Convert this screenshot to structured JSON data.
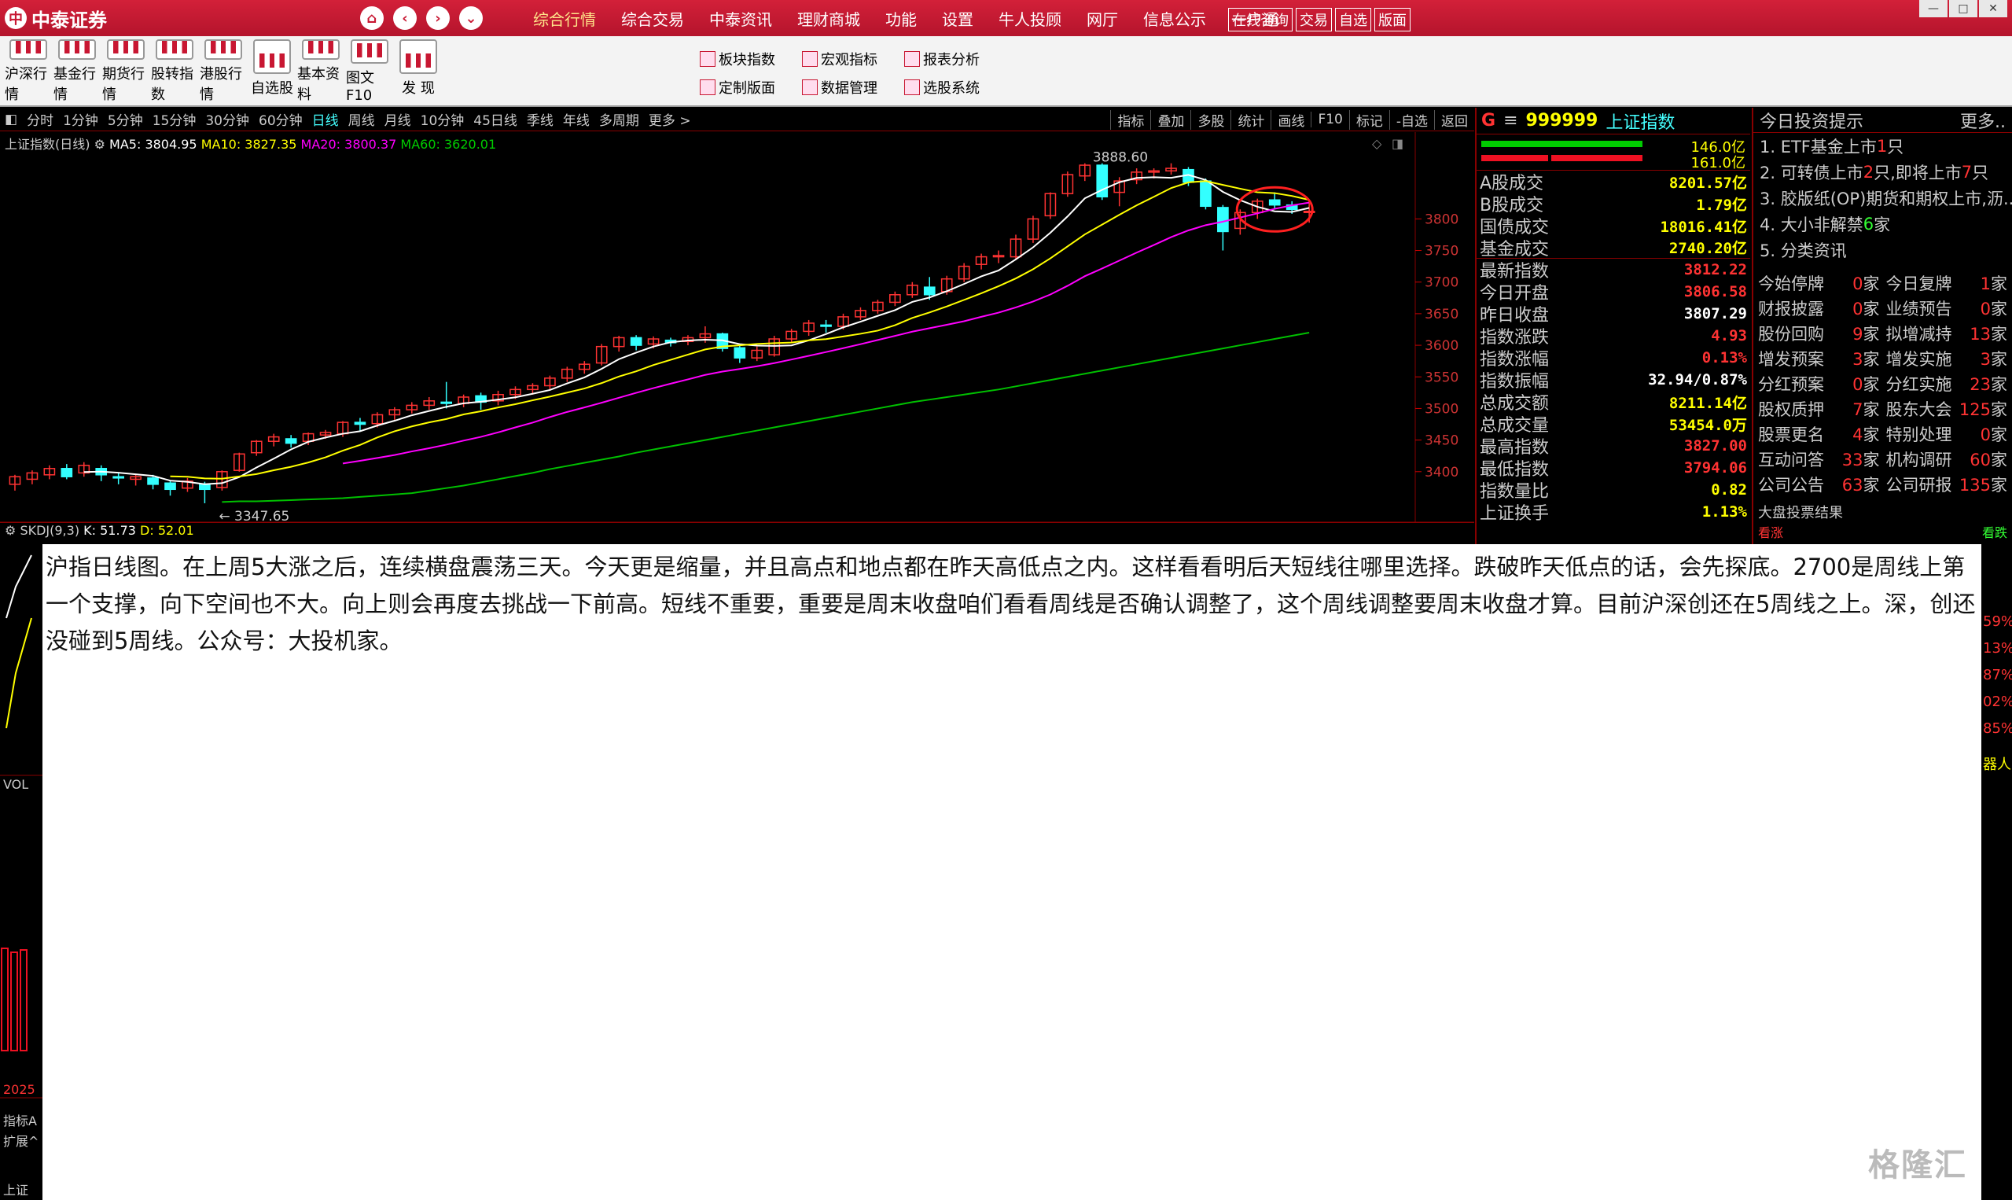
{
  "app": {
    "brand": "中泰证券",
    "brand_mark": "中"
  },
  "nav_icons": [
    "home-icon",
    "back-icon",
    "forward-icon",
    "dropdown-icon"
  ],
  "menu": [
    "综合行情",
    "综合交易",
    "中泰资讯",
    "理财商城",
    "功能",
    "设置",
    "牛人投顾",
    "网厅",
    "信息公示",
    "一户通"
  ],
  "quick_buttons": [
    "在线咨询",
    "交易",
    "自选",
    "版面"
  ],
  "window_controls": [
    "—",
    "□",
    "✕"
  ],
  "toolbar": {
    "buttons": [
      "沪深行情",
      "基金行情",
      "期货行情",
      "股转指数",
      "港股行情",
      "自选股",
      "基本资料",
      "图文F10",
      "发 现"
    ],
    "small": [
      "板块指数",
      "宏观指标",
      "报表分析",
      "定制版面",
      "数据管理",
      "选股系统"
    ]
  },
  "periods": [
    "分时",
    "1分钟",
    "5分钟",
    "15分钟",
    "30分钟",
    "60分钟",
    "日线",
    "周线",
    "月线",
    "10分钟",
    "45日线",
    "季线",
    "年线",
    "多周期",
    "更多 >"
  ],
  "period_active": "日线",
  "chart_tools": [
    "指标",
    "叠加",
    "多股",
    "统计",
    "画线",
    "F10",
    "标记",
    "-自选",
    "返回"
  ],
  "ma": {
    "title": "上证指数(日线)",
    "ma5": "MA5: 3804.95",
    "ma10": "MA10: 3827.35",
    "ma20": "MA20: 3800.37",
    "ma60": "MA60: 3620.01"
  },
  "skdj": {
    "label": "SKDJ(9,3)",
    "k": "K: 51.73",
    "d": "D: 52.01"
  },
  "colors": {
    "up": "#ff3333",
    "down": "#33ffff",
    "ma5": "#ffffff",
    "ma10": "#ffff00",
    "ma20": "#ff00ff",
    "ma60": "#00c000"
  },
  "chart_data": {
    "type": "candlestick",
    "y_ticks": [
      3400,
      3450,
      3500,
      3550,
      3600,
      3650,
      3700,
      3750,
      3800
    ],
    "ylim": [
      3340,
      3900
    ],
    "high_label": "3888.60",
    "low_label": "3347.65",
    "candles": [
      [
        3380,
        3392,
        3370,
        3395
      ],
      [
        3388,
        3398,
        3380,
        3402
      ],
      [
        3395,
        3405,
        3388,
        3410
      ],
      [
        3405,
        3392,
        3388,
        3412
      ],
      [
        3398,
        3410,
        3392,
        3415
      ],
      [
        3405,
        3395,
        3385,
        3410
      ],
      [
        3392,
        3390,
        3380,
        3398
      ],
      [
        3388,
        3392,
        3378,
        3396
      ],
      [
        3390,
        3380,
        3372,
        3395
      ],
      [
        3382,
        3372,
        3362,
        3386
      ],
      [
        3374,
        3385,
        3368,
        3390
      ],
      [
        3380,
        3372,
        3350,
        3384
      ],
      [
        3375,
        3400,
        3370,
        3402
      ],
      [
        3402,
        3428,
        3400,
        3430
      ],
      [
        3430,
        3448,
        3425,
        3450
      ],
      [
        3448,
        3455,
        3440,
        3460
      ],
      [
        3452,
        3445,
        3438,
        3458
      ],
      [
        3448,
        3460,
        3442,
        3462
      ],
      [
        3458,
        3462,
        3452,
        3466
      ],
      [
        3460,
        3478,
        3455,
        3480
      ],
      [
        3478,
        3475,
        3465,
        3485
      ],
      [
        3476,
        3490,
        3470,
        3494
      ],
      [
        3490,
        3498,
        3482,
        3502
      ],
      [
        3498,
        3505,
        3492,
        3510
      ],
      [
        3505,
        3512,
        3498,
        3518
      ],
      [
        3510,
        3508,
        3500,
        3542
      ],
      [
        3508,
        3518,
        3502,
        3522
      ],
      [
        3520,
        3510,
        3498,
        3525
      ],
      [
        3512,
        3522,
        3505,
        3528
      ],
      [
        3522,
        3530,
        3515,
        3535
      ],
      [
        3530,
        3536,
        3522,
        3540
      ],
      [
        3536,
        3548,
        3530,
        3552
      ],
      [
        3548,
        3562,
        3542,
        3566
      ],
      [
        3562,
        3570,
        3555,
        3575
      ],
      [
        3572,
        3598,
        3568,
        3602
      ],
      [
        3598,
        3612,
        3590,
        3615
      ],
      [
        3612,
        3600,
        3592,
        3616
      ],
      [
        3602,
        3610,
        3595,
        3614
      ],
      [
        3608,
        3604,
        3598,
        3612
      ],
      [
        3606,
        3612,
        3600,
        3616
      ],
      [
        3612,
        3618,
        3604,
        3630
      ],
      [
        3618,
        3595,
        3590,
        3620
      ],
      [
        3596,
        3580,
        3572,
        3600
      ],
      [
        3580,
        3592,
        3575,
        3598
      ],
      [
        3585,
        3610,
        3582,
        3615
      ],
      [
        3610,
        3622,
        3605,
        3626
      ],
      [
        3622,
        3635,
        3615,
        3640
      ],
      [
        3632,
        3630,
        3620,
        3640
      ],
      [
        3630,
        3645,
        3625,
        3650
      ],
      [
        3645,
        3655,
        3640,
        3660
      ],
      [
        3655,
        3668,
        3650,
        3672
      ],
      [
        3668,
        3680,
        3662,
        3685
      ],
      [
        3680,
        3695,
        3675,
        3700
      ],
      [
        3692,
        3680,
        3672,
        3708
      ],
      [
        3685,
        3705,
        3680,
        3710
      ],
      [
        3705,
        3725,
        3700,
        3730
      ],
      [
        3728,
        3740,
        3720,
        3745
      ],
      [
        3740,
        3742,
        3730,
        3750
      ],
      [
        3740,
        3768,
        3735,
        3775
      ],
      [
        3768,
        3800,
        3762,
        3805
      ],
      [
        3805,
        3840,
        3800,
        3842
      ],
      [
        3840,
        3870,
        3835,
        3875
      ],
      [
        3868,
        3885,
        3860,
        3888
      ],
      [
        3885,
        3835,
        3830,
        3888
      ],
      [
        3842,
        3860,
        3820,
        3866
      ],
      [
        3862,
        3874,
        3855,
        3880
      ],
      [
        3874,
        3876,
        3864,
        3880
      ],
      [
        3876,
        3880,
        3870,
        3888
      ],
      [
        3878,
        3858,
        3852,
        3882
      ],
      [
        3860,
        3820,
        3815,
        3864
      ],
      [
        3818,
        3780,
        3750,
        3822
      ],
      [
        3785,
        3810,
        3775,
        3815
      ],
      [
        3810,
        3828,
        3800,
        3832
      ],
      [
        3830,
        3822,
        3815,
        3842
      ],
      [
        3822,
        3815,
        3808,
        3828
      ],
      [
        3812,
        3812,
        3794,
        3827
      ]
    ],
    "ma60": [
      3352,
      3353,
      3353,
      3354,
      3355,
      3356,
      3357,
      3358,
      3360,
      3362,
      3364,
      3366,
      3370,
      3374,
      3378,
      3383,
      3388,
      3393,
      3398,
      3404,
      3409,
      3414,
      3419,
      3424,
      3430,
      3435,
      3440,
      3445,
      3450,
      3455,
      3460,
      3465,
      3470,
      3475,
      3480,
      3485,
      3490,
      3495,
      3500,
      3505,
      3510,
      3514,
      3518,
      3522,
      3526,
      3530,
      3535,
      3540,
      3545,
      3550,
      3555,
      3560,
      3565,
      3570,
      3575,
      3580,
      3585,
      3590,
      3595,
      3600,
      3605,
      3610,
      3615,
      3620
    ]
  },
  "quote": {
    "g": "G",
    "code": "999999",
    "name": "上证指数",
    "bar_vals": [
      "146.0亿",
      "161.0亿"
    ],
    "rows": [
      {
        "k": "A股成交",
        "v": "8201.57亿",
        "c": "#ffff00"
      },
      {
        "k": "B股成交",
        "v": "1.79亿",
        "c": "#ffff00"
      },
      {
        "k": "国债成交",
        "v": "18016.41亿",
        "c": "#ffff00"
      },
      {
        "k": "基金成交",
        "v": "2740.20亿",
        "c": "#ffff00"
      },
      {
        "k": "最新指数",
        "v": "3812.22",
        "c": "#ff3333"
      },
      {
        "k": "今日开盘",
        "v": "3806.58",
        "c": "#ff3333"
      },
      {
        "k": "昨日收盘",
        "v": "3807.29",
        "c": "#ffffff"
      },
      {
        "k": "指数涨跌",
        "v": "4.93",
        "c": "#ff3333"
      },
      {
        "k": "指数涨幅",
        "v": "0.13%",
        "c": "#ff3333"
      },
      {
        "k": "指数振幅",
        "v": "32.94/0.87%",
        "c": "#ffffff"
      },
      {
        "k": "总成交额",
        "v": "8211.14亿",
        "c": "#ffff00"
      },
      {
        "k": "总成交量",
        "v": "53454.0万",
        "c": "#ffff00"
      },
      {
        "k": "最高指数",
        "v": "3827.00",
        "c": "#ff3333"
      },
      {
        "k": "最低指数",
        "v": "3794.06",
        "c": "#ff3333"
      },
      {
        "k": "指数量比",
        "v": "0.82",
        "c": "#ffff00"
      },
      {
        "k": "上证换手",
        "v": "1.13%",
        "c": "#ffff00"
      }
    ]
  },
  "tips": {
    "title": "今日投资提示",
    "more": "更多..",
    "items": [
      {
        "pre": "1. ETF基金上市",
        "red": "1",
        "post": "只",
        "red2": "",
        "post2": ""
      },
      {
        "pre": "2. 可转债上市",
        "red": "2",
        "post": "只,即将上市",
        "red2": "7",
        "post2": "只"
      },
      {
        "pre": "3. 胶版纸(OP)期货和期权上市,沥..",
        "red": "",
        "post": "",
        "red2": "",
        "post2": ""
      },
      {
        "pre": "4. 大小非解禁 ",
        "red": "",
        "post": "",
        "green": "6",
        "post2": " 家"
      },
      {
        "pre": "5. 分类资讯",
        "red": "",
        "post": "",
        "red2": "",
        "post2": ""
      }
    ],
    "grid": [
      [
        {
          "k": "今始停牌",
          "n": "0",
          "u": "家"
        },
        {
          "k": "今日复牌",
          "n": "1",
          "u": "家"
        }
      ],
      [
        {
          "k": "财报披露",
          "n": "0",
          "u": "家"
        },
        {
          "k": "业绩预告",
          "n": "0",
          "u": "家"
        }
      ],
      [
        {
          "k": "股份回购",
          "n": "9",
          "u": "家"
        },
        {
          "k": "拟增减持",
          "n": "13",
          "u": "家"
        }
      ],
      [
        {
          "k": "增发预案",
          "n": "3",
          "u": "家"
        },
        {
          "k": "增发实施",
          "n": "3",
          "u": "家"
        }
      ],
      [
        {
          "k": "分红预案",
          "n": "0",
          "u": "家"
        },
        {
          "k": "分红实施",
          "n": "23",
          "u": "家"
        }
      ],
      [
        {
          "k": "股权质押",
          "n": "7",
          "u": "家"
        },
        {
          "k": "股东大会",
          "n": "125",
          "u": "家"
        }
      ],
      [
        {
          "k": "股票更名",
          "n": "4",
          "u": "家"
        },
        {
          "k": "特别处理",
          "n": "0",
          "u": "家"
        }
      ],
      [
        {
          "k": "互动问答",
          "n": "33",
          "u": "家"
        },
        {
          "k": "机构调研",
          "n": "60",
          "u": "家"
        }
      ],
      [
        {
          "k": "公司公告",
          "n": "63",
          "u": "家"
        },
        {
          "k": "公司研报",
          "n": "135",
          "u": "家"
        }
      ]
    ],
    "vote_title": "大盘投票结果",
    "vote_up": "看涨",
    "vote_down": "看跌"
  },
  "overlay_text": "沪指日线图。在上周5大涨之后，连续横盘震荡三天。今天更是缩量，并且高点和地点都在昨天高低点之内。这样看看明后天短线往哪里选择。跌破昨天低点的话，会先探底。2700是周线上第一个支撑，向下空间也不大。向上则会再度去挑战一下前高。短线不重要，重要是周末收盘咱们看看周线是否确认调整了，这个周线调整要周末收盘才算。目前沪深创还在5周线之上。深，创还没碰到5周线。公众号：大投机家。",
  "left_strip": [
    "VOL",
    "2025",
    "指标A",
    "扩展^",
    "上证"
  ],
  "right_strip": [
    "59%",
    "13%",
    "87%",
    "02%",
    "85%",
    "器人"
  ],
  "watermark": "格隆汇"
}
